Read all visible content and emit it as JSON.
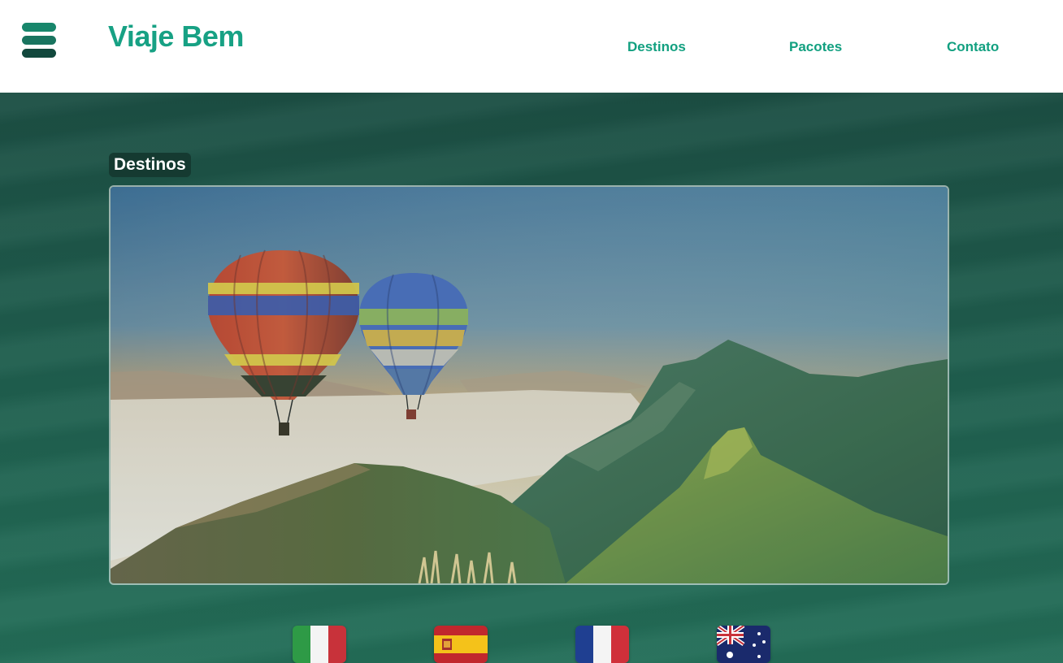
{
  "header": {
    "logo": "Viaje Bem",
    "menu_icon": "hamburger-menu-icon",
    "nav": [
      {
        "label": "Destinos"
      },
      {
        "label": "Pacotes"
      },
      {
        "label": "Contato"
      }
    ]
  },
  "main": {
    "section_title": "Destinos",
    "banner_image": "hot-air-balloons-over-mountains"
  },
  "flags": [
    {
      "country": "italy-flag-icon"
    },
    {
      "country": "spain-flag-icon"
    },
    {
      "country": "france-flag-icon"
    },
    {
      "country": "australia-flag-icon"
    }
  ],
  "colors": {
    "brand": "#17a184",
    "nav": "#12a080",
    "hero_bg": "#1f5e4e",
    "title_bg": "#153a31"
  }
}
